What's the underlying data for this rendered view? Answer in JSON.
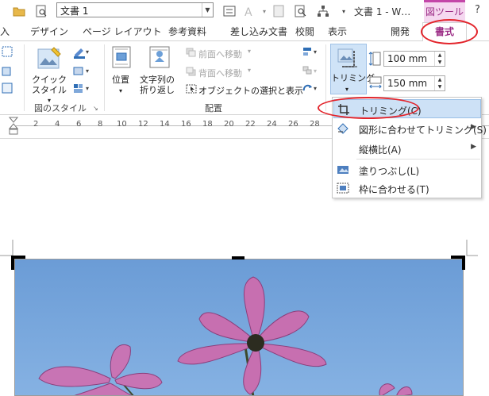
{
  "quick_access": {
    "document_combo_value": "文書 1",
    "window_title": "文書 1 - W…",
    "context_tab": "図ツール",
    "help": "?"
  },
  "tabs": [
    "入",
    "デザイン",
    "ページ レイアウト",
    "参考資料",
    "差し込み文書",
    "校閲",
    "表示",
    "開発",
    "書式"
  ],
  "ribbon": {
    "quick_style_label": "クイック\nスタイル",
    "picture_styles_group": "図のスタイル",
    "position_label": "位置",
    "wrap_text_label": "文字列の\n折り返し",
    "bring_forward": "前面へ移動",
    "send_backward": "背面へ移動",
    "selection_pane": "オブジェクトの選択と表示",
    "arrange_group": "配置",
    "crop_label": "トリミング",
    "height_value": "100 mm",
    "width_value": "150 mm"
  },
  "ruler_numbers": [
    "2",
    "4",
    "6",
    "8",
    "10",
    "12",
    "14",
    "16",
    "18",
    "20",
    "22",
    "24",
    "26",
    "28"
  ],
  "crop_menu": {
    "items": [
      {
        "label": "トリミング(C)",
        "icon": "crop-icon",
        "submenu": false
      },
      {
        "label": "図形に合わせてトリミング(S)",
        "icon": "crop-to-shape-icon",
        "submenu": true
      },
      {
        "label": "縦横比(A)",
        "icon": "",
        "submenu": true
      },
      {
        "label": "塗りつぶし(L)",
        "icon": "fill-icon",
        "submenu": false
      },
      {
        "label": "枠に合わせる(T)",
        "icon": "fit-icon",
        "submenu": false
      }
    ]
  },
  "colors": {
    "accent": "#9c2d86",
    "annotation": "#e3242b",
    "highlight": "#cde1f6",
    "sky": "#6fa0d8"
  }
}
